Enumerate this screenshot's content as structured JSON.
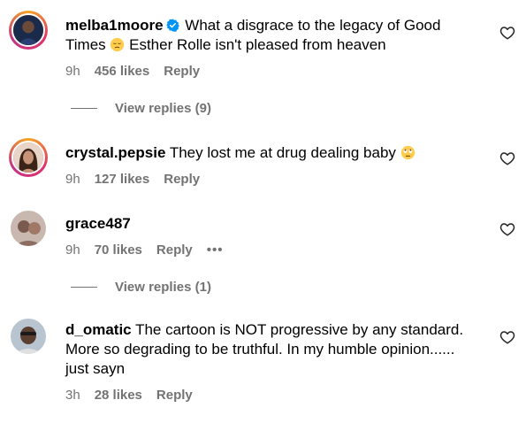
{
  "comments": [
    {
      "username": "melba1moore",
      "verified": true,
      "text_before": "What a disgrace to the legacy of Good Times",
      "text_after": "Esther Rolle isn't pleased from heaven",
      "emoji": "pensive-face",
      "time": "9h",
      "likes": "456 likes",
      "reply": "Reply",
      "view_replies": "View replies (9)"
    },
    {
      "username": "crystal.pepsie",
      "text": "They lost me at drug dealing baby",
      "emoji": "eye-roll-face",
      "time": "9h",
      "likes": "127 likes",
      "reply": "Reply"
    },
    {
      "username": "grace487",
      "text": "",
      "time": "9h",
      "likes": "70 likes",
      "reply": "Reply",
      "more": "•••",
      "view_replies": "View replies (1)"
    },
    {
      "username": "d_omatic",
      "text": "The cartoon is NOT progressive by any standard. More so degrading to be truthful. In my humble opinion...... just sayn",
      "time": "3h",
      "likes": "28 likes",
      "reply": "Reply"
    }
  ],
  "colors": {
    "secondary_text": "#737373",
    "verified_blue": "#0095f6",
    "story_ring": "#e1306c"
  },
  "icons": {
    "like": "heart-outline-icon",
    "verified": "verified-badge-icon"
  }
}
